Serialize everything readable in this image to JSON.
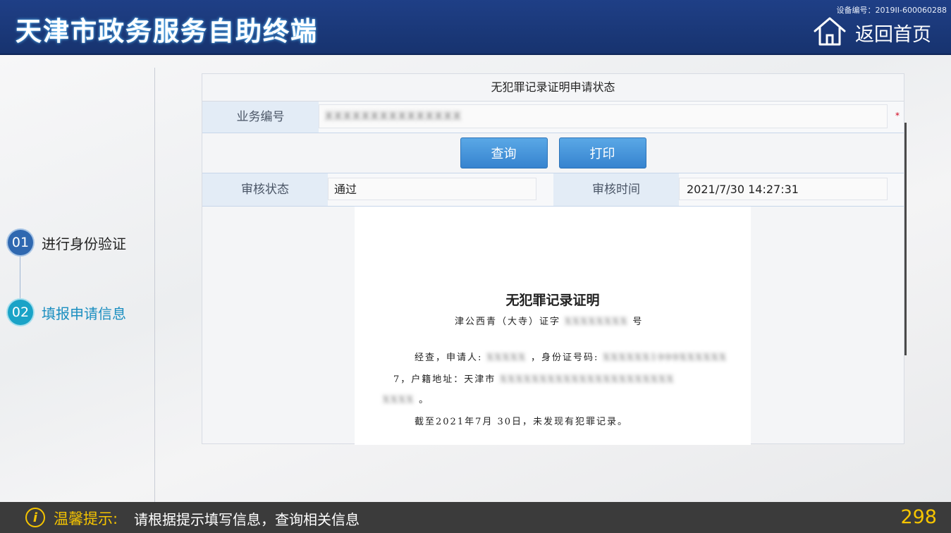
{
  "header": {
    "title": "天津市政务服务自助终端",
    "device_no": "设备编号：2019II-600060288",
    "home_label": "返回首页"
  },
  "steps": [
    {
      "num": "01",
      "label": "进行身份验证"
    },
    {
      "num": "02",
      "label": "填报申请信息"
    }
  ],
  "form": {
    "title": "无犯罪记录证明申请状态",
    "business_no_label": "业务编号",
    "business_no_value": "XXXXXXXXXXXXXXX",
    "required_mark": "*",
    "query_button": "查询",
    "print_button": "打印",
    "review_status_label": "审核状态",
    "review_status_value": "通过",
    "review_time_label": "审核时间",
    "review_time_value": "2021/7/30 14:27:31"
  },
  "certificate": {
    "title": "无犯罪记录证明",
    "doc_no_prefix": "津公西青（大寺）证字",
    "doc_no_redacted": "XXXXXXXX",
    "doc_no_suffix": "号",
    "line1_prefix": "经查，申请人:",
    "name_redacted": "XXXXX",
    "line1_mid": "，身份证号码:",
    "id_redacted": "XXXXXX1999XXXXXX",
    "line2_prefix": "7，户籍地址：天津市",
    "address_redacted": "XXXXXXXXXXXXXXXXXXXXXX",
    "line3_redacted": "XXXX",
    "line3_suffix": "。",
    "line4": "截至2021年7月 30日，未发现有犯罪记录。"
  },
  "footer": {
    "tip_icon": "i",
    "tip_label": "温馨提示:",
    "tip_text": "请根据提示填写信息，查询相关信息",
    "countdown": "298"
  },
  "colors": {
    "header_bg": "#1f3f86",
    "button_blue": "#4a98de",
    "step_active": "#1aa3c7",
    "footer_accent": "#f5c400",
    "required_red": "#d0021b"
  }
}
